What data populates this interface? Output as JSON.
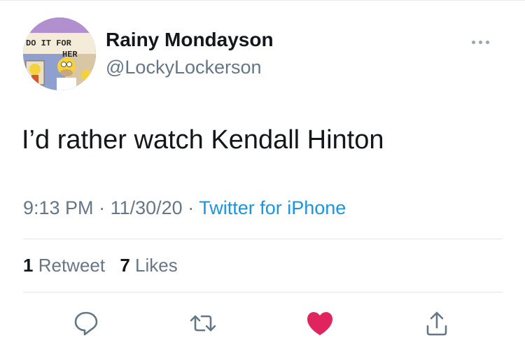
{
  "user": {
    "display_name": "Rainy Mondayson",
    "handle": "@LockyLockerson",
    "avatar_sign_line1": "DO IT FOR",
    "avatar_sign_line2": "HER"
  },
  "tweet": {
    "text": "I’d rather watch Kendall Hinton",
    "time": "9:13 PM",
    "date": "11/30/20",
    "separator": "·",
    "source": "Twitter for iPhone"
  },
  "stats": {
    "retweets_count": "1",
    "retweets_label": "Retweet",
    "likes_count": "7",
    "likes_label": "Likes"
  },
  "actions": [
    "reply-icon",
    "retweet-icon",
    "like-icon",
    "share-icon"
  ],
  "colors": {
    "like": "#e0245e",
    "link": "#1b95e0",
    "secondary_text": "#657786"
  }
}
